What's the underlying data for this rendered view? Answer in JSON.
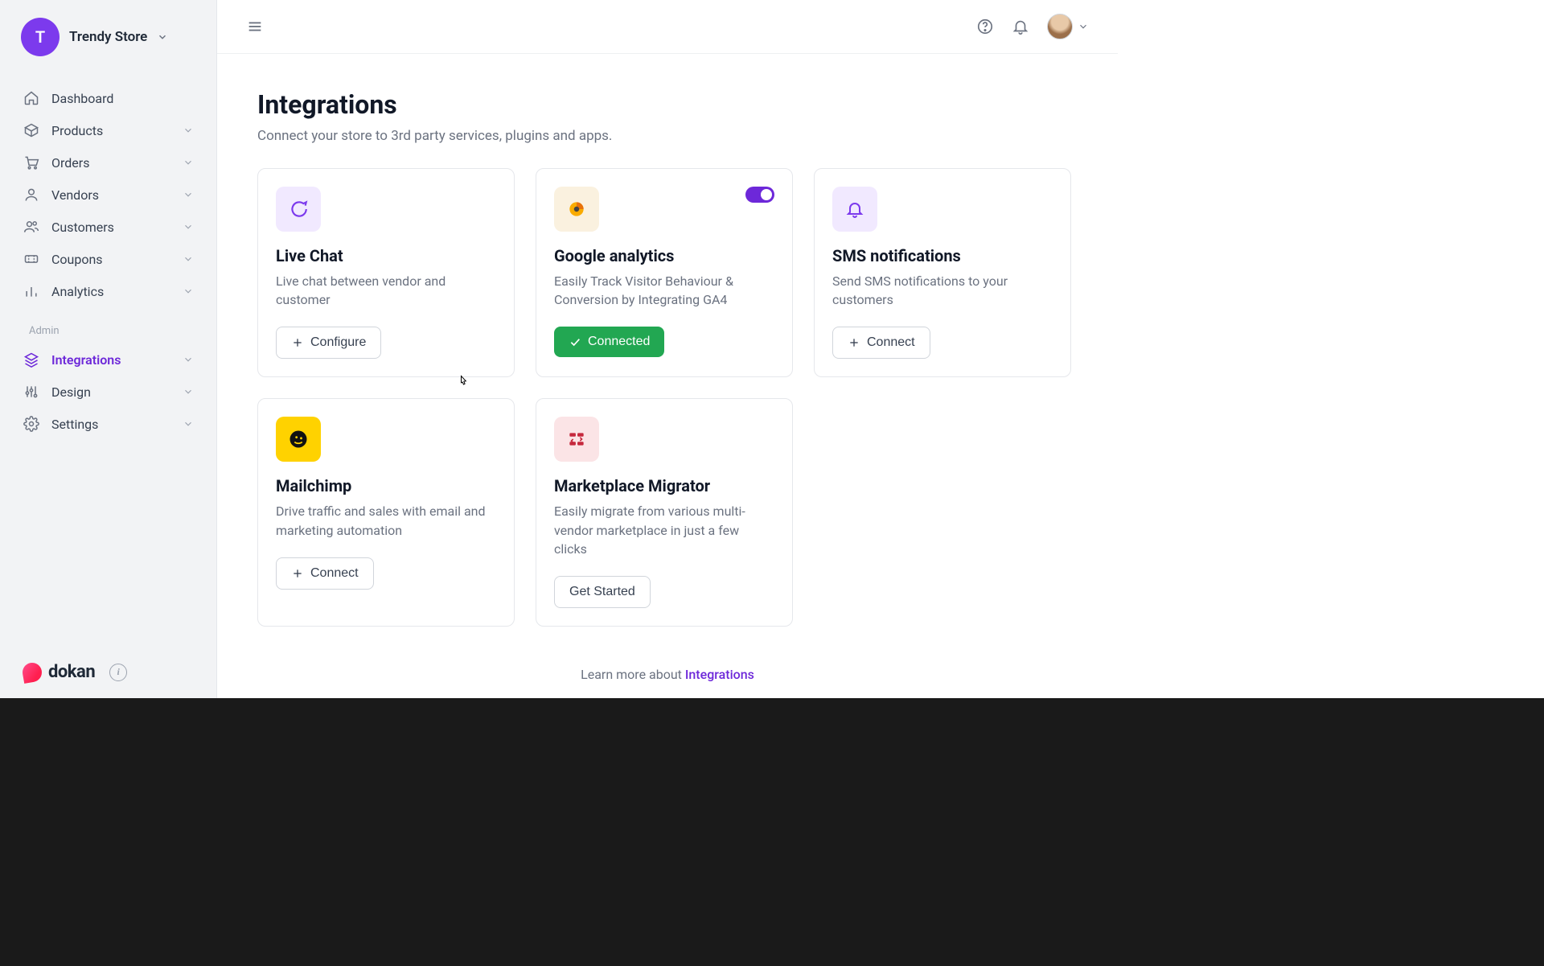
{
  "store": {
    "initial": "T",
    "name": "Trendy Store"
  },
  "sidebar": {
    "items": [
      {
        "label": "Dashboard",
        "expandable": false
      },
      {
        "label": "Products",
        "expandable": true
      },
      {
        "label": "Orders",
        "expandable": true
      },
      {
        "label": "Vendors",
        "expandable": true
      },
      {
        "label": "Customers",
        "expandable": true
      },
      {
        "label": "Coupons",
        "expandable": true
      },
      {
        "label": "Analytics",
        "expandable": true
      }
    ],
    "admin_label": "Admin",
    "admin_items": [
      {
        "label": "Integrations",
        "active": true
      },
      {
        "label": "Design"
      },
      {
        "label": "Settings"
      }
    ],
    "brand": "dokan"
  },
  "page": {
    "title": "Integrations",
    "subtitle": "Connect your store to 3rd party services, plugins and apps."
  },
  "cards": [
    {
      "id": "live-chat",
      "title": "Live Chat",
      "desc": "Live chat between vendor and customer",
      "action": "Configure",
      "action_type": "configure"
    },
    {
      "id": "google-analytics",
      "title": "Google analytics",
      "desc": "Easily Track Visitor Behaviour & Conversion by Integrating GA4",
      "action": "Connected",
      "action_type": "connected",
      "toggle_on": true
    },
    {
      "id": "sms",
      "title": "SMS notifications",
      "desc": "Send SMS notifications to your customers",
      "action": "Connect",
      "action_type": "connect"
    },
    {
      "id": "mailchimp",
      "title": "Mailchimp",
      "desc": "Drive traffic and sales with email and marketing automation",
      "action": "Connect",
      "action_type": "connect"
    },
    {
      "id": "migrator",
      "title": "Marketplace Migrator",
      "desc": "Easily migrate from various multi-vendor marketplace in just a few clicks",
      "action": "Get Started",
      "action_type": "plain"
    }
  ],
  "footer": {
    "prefix": "Learn more about ",
    "link": "Integrations"
  }
}
